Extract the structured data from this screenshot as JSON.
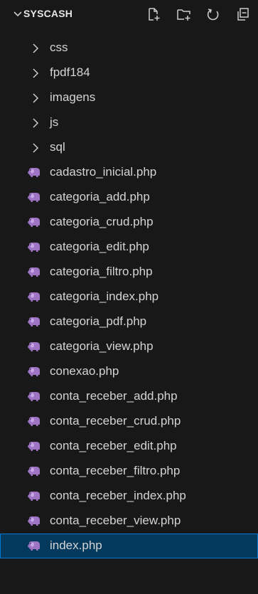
{
  "explorer": {
    "title": "SYSCASH",
    "header_icons": [
      "new-file-icon",
      "new-folder-icon",
      "refresh-icon",
      "collapse-all-icon"
    ],
    "folders": [
      {
        "label": "css"
      },
      {
        "label": "fpdf184"
      },
      {
        "label": "imagens"
      },
      {
        "label": "js"
      },
      {
        "label": "sql"
      }
    ],
    "files": [
      {
        "label": "cadastro_inicial.php"
      },
      {
        "label": "categoria_add.php"
      },
      {
        "label": "categoria_crud.php"
      },
      {
        "label": "categoria_edit.php"
      },
      {
        "label": "categoria_filtro.php"
      },
      {
        "label": "categoria_index.php"
      },
      {
        "label": "categoria_pdf.php"
      },
      {
        "label": "categoria_view.php"
      },
      {
        "label": "conexao.php"
      },
      {
        "label": "conta_receber_add.php"
      },
      {
        "label": "conta_receber_crud.php"
      },
      {
        "label": "conta_receber_edit.php"
      },
      {
        "label": "conta_receber_filtro.php"
      },
      {
        "label": "conta_receber_index.php"
      },
      {
        "label": "conta_receber_view.php"
      },
      {
        "label": "index.php",
        "selected": true
      }
    ]
  },
  "colors": {
    "background": "#181818",
    "text": "#d4d4d4",
    "php_icon": "#a074c4",
    "selection_bg": "#04395e",
    "selection_border": "#0078d4"
  }
}
